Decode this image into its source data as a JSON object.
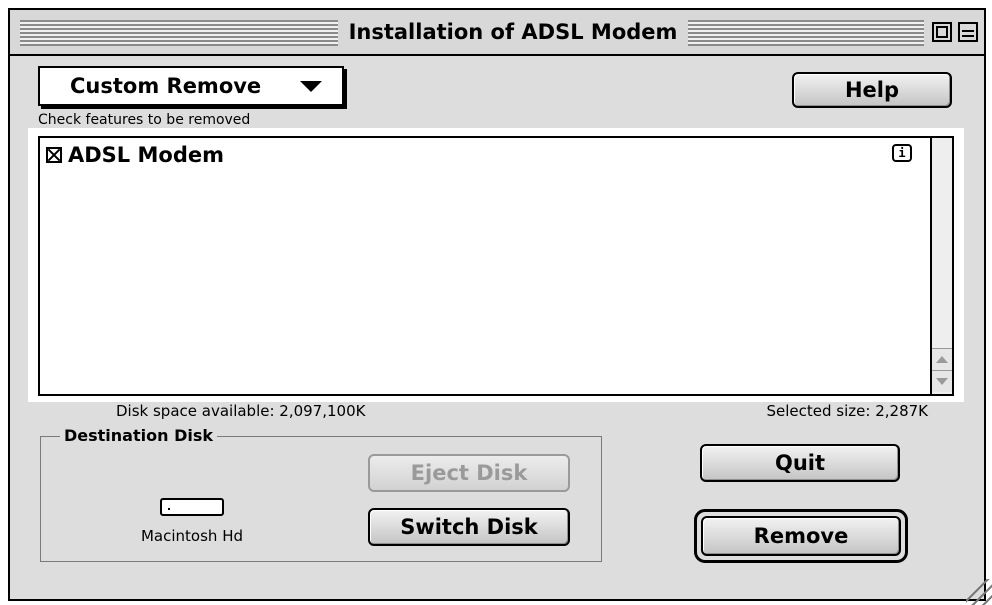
{
  "window": {
    "title": "Installation of ADSL Modem",
    "zoom_icon": "zoom-box-icon",
    "collapse_icon": "windowshade-icon"
  },
  "install_type": {
    "selected": "Custom Remove",
    "icon": "dropdown-arrow-icon"
  },
  "help_button": "Help",
  "features_list": {
    "caption": "Check features to be removed",
    "items": [
      {
        "label": "ADSL Modem",
        "checked": true,
        "info_icon": "i"
      }
    ]
  },
  "disk_space": "Disk space available: 2,097,100K",
  "selected_size": "Selected size: 2,287K",
  "destination": {
    "group_label": "Destination Disk",
    "disk_name": "Macintosh Hd",
    "disk_icon": "hard-disk-icon",
    "eject_button": "Eject Disk",
    "switch_button": "Switch Disk"
  },
  "quit_button": "Quit",
  "remove_button": "Remove",
  "colors": {
    "window_bg": "#dddddd",
    "disabled_text": "#9a9a9a"
  }
}
